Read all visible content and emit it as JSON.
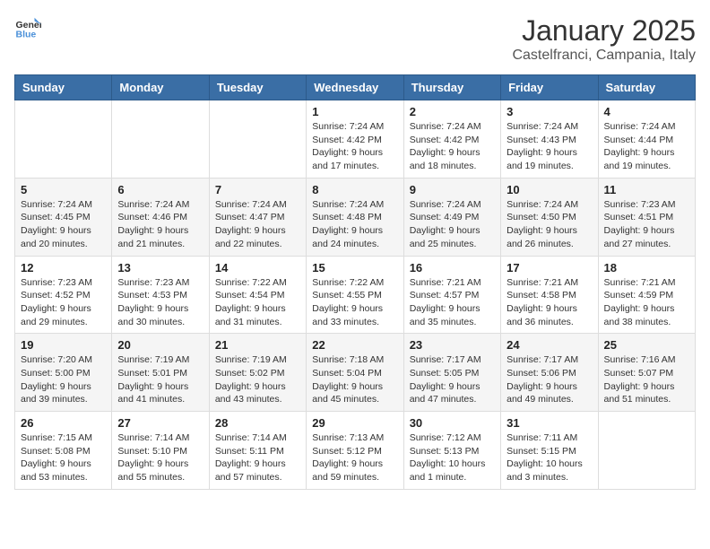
{
  "logo": {
    "general": "General",
    "blue": "Blue"
  },
  "title": "January 2025",
  "subtitle": "Castelfranci, Campania, Italy",
  "weekdays": [
    "Sunday",
    "Monday",
    "Tuesday",
    "Wednesday",
    "Thursday",
    "Friday",
    "Saturday"
  ],
  "weeks": [
    [
      {
        "day": "",
        "info": ""
      },
      {
        "day": "",
        "info": ""
      },
      {
        "day": "",
        "info": ""
      },
      {
        "day": "1",
        "info": "Sunrise: 7:24 AM\nSunset: 4:42 PM\nDaylight: 9 hours\nand 17 minutes."
      },
      {
        "day": "2",
        "info": "Sunrise: 7:24 AM\nSunset: 4:42 PM\nDaylight: 9 hours\nand 18 minutes."
      },
      {
        "day": "3",
        "info": "Sunrise: 7:24 AM\nSunset: 4:43 PM\nDaylight: 9 hours\nand 19 minutes."
      },
      {
        "day": "4",
        "info": "Sunrise: 7:24 AM\nSunset: 4:44 PM\nDaylight: 9 hours\nand 19 minutes."
      }
    ],
    [
      {
        "day": "5",
        "info": "Sunrise: 7:24 AM\nSunset: 4:45 PM\nDaylight: 9 hours\nand 20 minutes."
      },
      {
        "day": "6",
        "info": "Sunrise: 7:24 AM\nSunset: 4:46 PM\nDaylight: 9 hours\nand 21 minutes."
      },
      {
        "day": "7",
        "info": "Sunrise: 7:24 AM\nSunset: 4:47 PM\nDaylight: 9 hours\nand 22 minutes."
      },
      {
        "day": "8",
        "info": "Sunrise: 7:24 AM\nSunset: 4:48 PM\nDaylight: 9 hours\nand 24 minutes."
      },
      {
        "day": "9",
        "info": "Sunrise: 7:24 AM\nSunset: 4:49 PM\nDaylight: 9 hours\nand 25 minutes."
      },
      {
        "day": "10",
        "info": "Sunrise: 7:24 AM\nSunset: 4:50 PM\nDaylight: 9 hours\nand 26 minutes."
      },
      {
        "day": "11",
        "info": "Sunrise: 7:23 AM\nSunset: 4:51 PM\nDaylight: 9 hours\nand 27 minutes."
      }
    ],
    [
      {
        "day": "12",
        "info": "Sunrise: 7:23 AM\nSunset: 4:52 PM\nDaylight: 9 hours\nand 29 minutes."
      },
      {
        "day": "13",
        "info": "Sunrise: 7:23 AM\nSunset: 4:53 PM\nDaylight: 9 hours\nand 30 minutes."
      },
      {
        "day": "14",
        "info": "Sunrise: 7:22 AM\nSunset: 4:54 PM\nDaylight: 9 hours\nand 31 minutes."
      },
      {
        "day": "15",
        "info": "Sunrise: 7:22 AM\nSunset: 4:55 PM\nDaylight: 9 hours\nand 33 minutes."
      },
      {
        "day": "16",
        "info": "Sunrise: 7:21 AM\nSunset: 4:57 PM\nDaylight: 9 hours\nand 35 minutes."
      },
      {
        "day": "17",
        "info": "Sunrise: 7:21 AM\nSunset: 4:58 PM\nDaylight: 9 hours\nand 36 minutes."
      },
      {
        "day": "18",
        "info": "Sunrise: 7:21 AM\nSunset: 4:59 PM\nDaylight: 9 hours\nand 38 minutes."
      }
    ],
    [
      {
        "day": "19",
        "info": "Sunrise: 7:20 AM\nSunset: 5:00 PM\nDaylight: 9 hours\nand 39 minutes."
      },
      {
        "day": "20",
        "info": "Sunrise: 7:19 AM\nSunset: 5:01 PM\nDaylight: 9 hours\nand 41 minutes."
      },
      {
        "day": "21",
        "info": "Sunrise: 7:19 AM\nSunset: 5:02 PM\nDaylight: 9 hours\nand 43 minutes."
      },
      {
        "day": "22",
        "info": "Sunrise: 7:18 AM\nSunset: 5:04 PM\nDaylight: 9 hours\nand 45 minutes."
      },
      {
        "day": "23",
        "info": "Sunrise: 7:17 AM\nSunset: 5:05 PM\nDaylight: 9 hours\nand 47 minutes."
      },
      {
        "day": "24",
        "info": "Sunrise: 7:17 AM\nSunset: 5:06 PM\nDaylight: 9 hours\nand 49 minutes."
      },
      {
        "day": "25",
        "info": "Sunrise: 7:16 AM\nSunset: 5:07 PM\nDaylight: 9 hours\nand 51 minutes."
      }
    ],
    [
      {
        "day": "26",
        "info": "Sunrise: 7:15 AM\nSunset: 5:08 PM\nDaylight: 9 hours\nand 53 minutes."
      },
      {
        "day": "27",
        "info": "Sunrise: 7:14 AM\nSunset: 5:10 PM\nDaylight: 9 hours\nand 55 minutes."
      },
      {
        "day": "28",
        "info": "Sunrise: 7:14 AM\nSunset: 5:11 PM\nDaylight: 9 hours\nand 57 minutes."
      },
      {
        "day": "29",
        "info": "Sunrise: 7:13 AM\nSunset: 5:12 PM\nDaylight: 9 hours\nand 59 minutes."
      },
      {
        "day": "30",
        "info": "Sunrise: 7:12 AM\nSunset: 5:13 PM\nDaylight: 10 hours\nand 1 minute."
      },
      {
        "day": "31",
        "info": "Sunrise: 7:11 AM\nSunset: 5:15 PM\nDaylight: 10 hours\nand 3 minutes."
      },
      {
        "day": "",
        "info": ""
      }
    ]
  ]
}
